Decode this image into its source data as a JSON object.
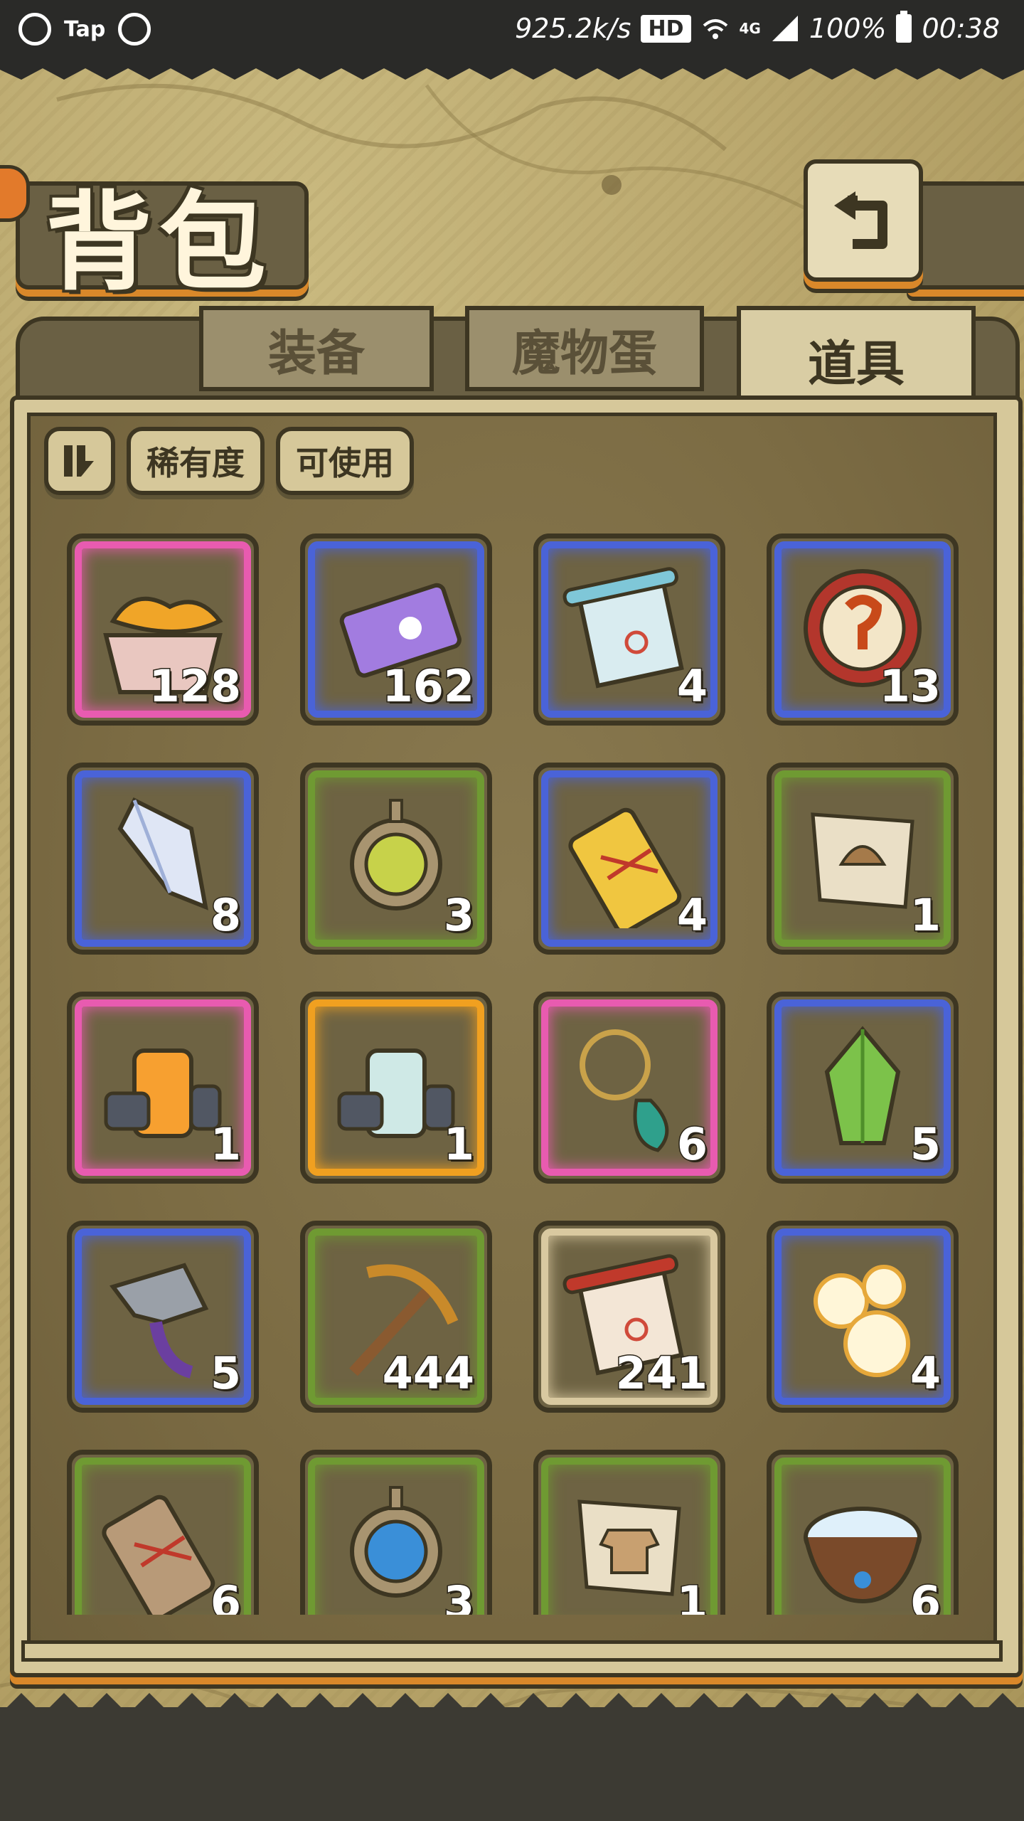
{
  "status_bar": {
    "app_label": "Tap",
    "speed": "925.2k/s",
    "hd": "HD",
    "network": "4G",
    "battery": "100%",
    "time": "00:38"
  },
  "header": {
    "title": "背包",
    "back_icon": "return-arrow-icon"
  },
  "tabs": [
    {
      "label": "装备",
      "active": false
    },
    {
      "label": "魔物蛋",
      "active": false
    },
    {
      "label": "道具",
      "active": true
    }
  ],
  "filters": {
    "sort_icon": "sort-toggle-icon",
    "rarity_label": "稀有度",
    "usable_label": "可使用"
  },
  "colors": {
    "pink": "#e85bb0",
    "blue": "#4a63d8",
    "green": "#6f9a32",
    "orange": "#f0a020",
    "beige": "#d9c9a0"
  },
  "items": [
    {
      "name": "bread-basket-icon",
      "count": "128",
      "rarity": "pink"
    },
    {
      "name": "ticket-icon",
      "count": "162",
      "rarity": "blue"
    },
    {
      "name": "blue-scroll-icon",
      "count": "4",
      "rarity": "blue"
    },
    {
      "name": "red-coin-icon",
      "count": "13",
      "rarity": "blue"
    },
    {
      "name": "crystal-shard-icon",
      "count": "8",
      "rarity": "blue"
    },
    {
      "name": "leaf-compass-icon",
      "count": "3",
      "rarity": "green"
    },
    {
      "name": "fish-tag-gold-icon",
      "count": "4",
      "rarity": "blue"
    },
    {
      "name": "hat-map-icon",
      "count": "1",
      "rarity": "green"
    },
    {
      "name": "lantern-orange-icon",
      "count": "1",
      "rarity": "pink"
    },
    {
      "name": "lantern-rainbow-icon",
      "count": "1",
      "rarity": "orange"
    },
    {
      "name": "flower-necklace-icon",
      "count": "6",
      "rarity": "pink"
    },
    {
      "name": "green-crystal-icon",
      "count": "5",
      "rarity": "blue"
    },
    {
      "name": "fish-bone-icon",
      "count": "5",
      "rarity": "blue"
    },
    {
      "name": "pickaxe-icon",
      "count": "444",
      "rarity": "green"
    },
    {
      "name": "red-scroll-icon",
      "count": "241",
      "rarity": "beige"
    },
    {
      "name": "golden-orbs-icon",
      "count": "4",
      "rarity": "blue"
    },
    {
      "name": "fish-tag-wood-icon",
      "count": "6",
      "rarity": "green"
    },
    {
      "name": "water-compass-icon",
      "count": "3",
      "rarity": "green"
    },
    {
      "name": "shirt-map-icon",
      "count": "1",
      "rarity": "green"
    },
    {
      "name": "water-bowl-icon",
      "count": "6",
      "rarity": "green"
    }
  ]
}
